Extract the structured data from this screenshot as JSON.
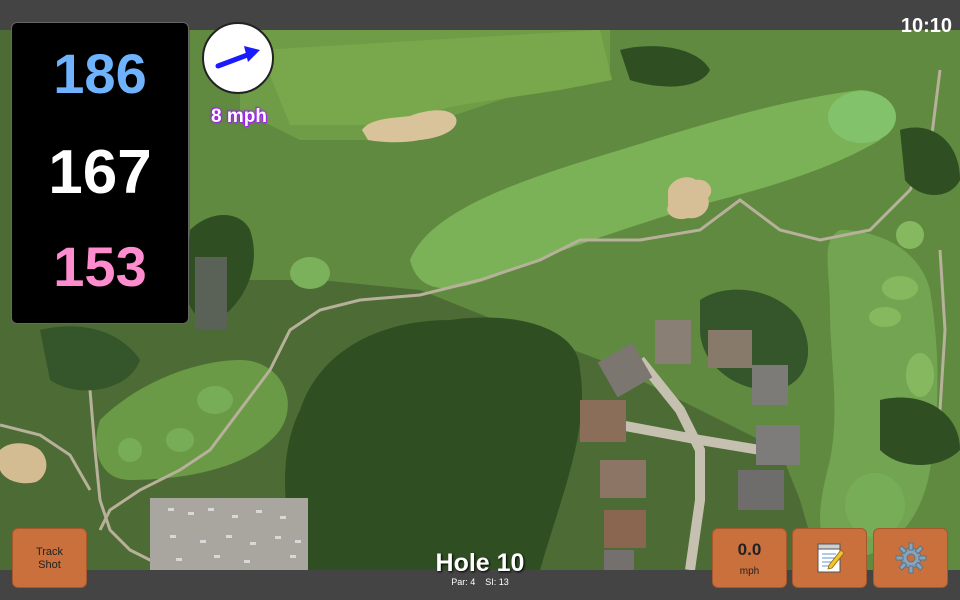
{
  "status": {
    "time": "10:10"
  },
  "distances": {
    "back": "186",
    "middle": "167",
    "front": "153",
    "colors": {
      "back": "#6fb3ff",
      "middle": "#ffffff",
      "front": "#ff8ccf"
    }
  },
  "wind": {
    "speed": "8 mph",
    "direction_icon": "arrow-right-up-icon"
  },
  "hole": {
    "title": "Hole 10",
    "par": "Par: 4",
    "si": "SI: 13"
  },
  "buttons": {
    "track_shot_line1": "Track",
    "track_shot_line2": "Shot",
    "speed_value": "0.0",
    "speed_unit": "mph",
    "notes_icon": "notepad-icon",
    "settings_icon": "gear-icon",
    "accent_color": "#c9703c"
  }
}
